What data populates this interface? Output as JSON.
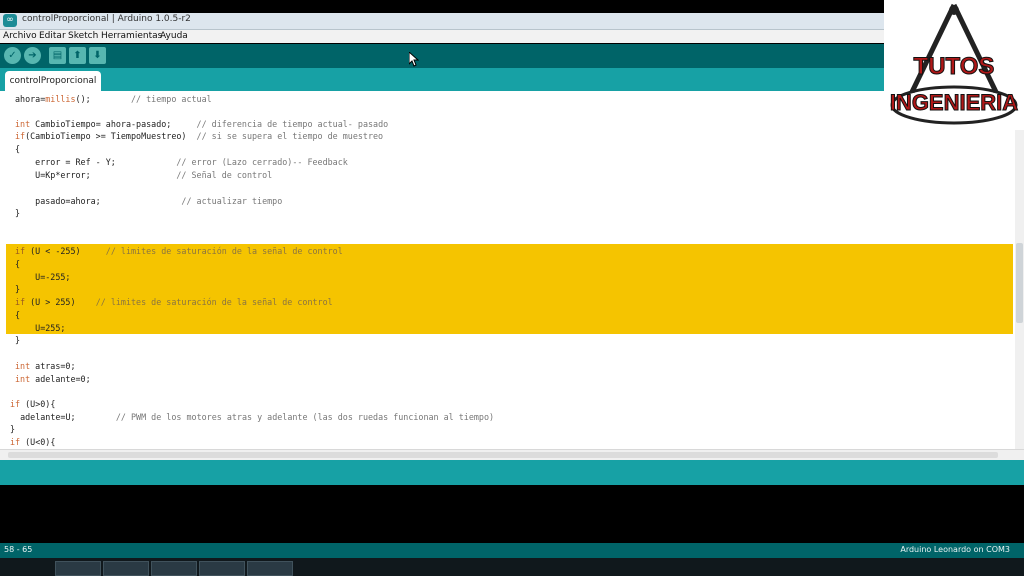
{
  "window": {
    "title": "controlProporcional | Arduino 1.0.5-r2"
  },
  "menubar": {
    "items": [
      "Archivo",
      "Editar",
      "Sketch",
      "Herramientas",
      "Ayuda"
    ]
  },
  "toolbar": {
    "buttons": [
      "verify",
      "upload",
      "new",
      "open",
      "save"
    ]
  },
  "tabs": [
    {
      "label": "controlProporcional"
    }
  ],
  "code": [
    "ahora=millis();        // tiempo actual",
    "",
    "int CambioTiempo= ahora-pasado;     // diferencia de tiempo actual- pasado",
    "if(CambioTiempo >= TiempoMuestreo)  // si se supera el tiempo de muestreo",
    "{",
    "    error = Ref - Y;            // error (Lazo cerrado)-- Feedback",
    "    U=Kp*error;                 // Señal de control",
    "",
    "    pasado=ahora;                // actualizar tiempo",
    "}",
    "",
    "",
    "if (U < -255)     // limites de saturación de la señal de control",
    "{",
    "    U=-255;",
    "}",
    "if (U > 255)    // limites de saturación de la señal de control",
    "{",
    "    U=255;",
    "}",
    "",
    "int atras=0;",
    "int adelante=0;",
    "",
    "if (U>0){",
    "  adelante=U;        // PWM de los motores atras y adelante (las dos ruedas funcionan al tiempo)",
    "}",
    "if (U<0){"
  ],
  "status": {
    "line_range": "58 - 65",
    "board": "Arduino Leonardo on COM3"
  },
  "logo": {
    "text_top": "TUTOS",
    "text_bottom": "INGENIERIA"
  },
  "colors": {
    "toolbar": "#006468",
    "tabbar": "#17a1a5",
    "highlight": "#f5c400"
  }
}
